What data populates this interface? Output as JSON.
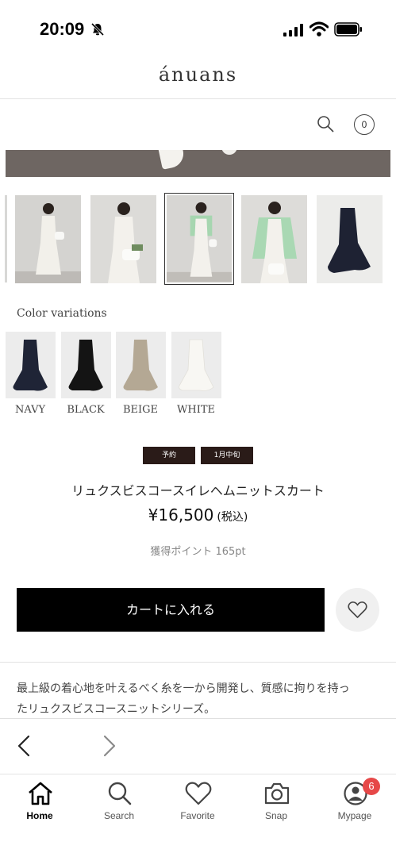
{
  "status_bar": {
    "time": "20:09"
  },
  "header": {
    "logo": "ánuans",
    "cart_count": "0"
  },
  "color_variations": {
    "title": "Color variations",
    "items": [
      {
        "label": "NAVY",
        "color": "#1f2436"
      },
      {
        "label": "BLACK",
        "color": "#141414"
      },
      {
        "label": "BEIGE",
        "color": "#b4a894"
      },
      {
        "label": "WHITE",
        "color": "#f4f2ec"
      }
    ]
  },
  "product": {
    "tags": [
      "予約",
      "1月中旬"
    ],
    "name": "リュクスビスコースイレヘムニットスカート",
    "price": "¥16,500",
    "tax_label": "(税込)",
    "points": "獲得ポイント 165pt",
    "cart_button": "カートに入れる",
    "description_line1": "最上級の着心地を叶えるべく糸を一から開発し、質感に拘りを持っ",
    "description_line2": "たリュクスビスコースニットシリーズ。"
  },
  "tabbar": {
    "items": [
      {
        "label": "Home",
        "icon": "home-icon"
      },
      {
        "label": "Search",
        "icon": "search-icon"
      },
      {
        "label": "Favorite",
        "icon": "heart-icon"
      },
      {
        "label": "Snap",
        "icon": "camera-icon"
      },
      {
        "label": "Mypage",
        "icon": "user-icon"
      }
    ],
    "mypage_badge": "6"
  },
  "colors": {
    "accent": "#000000",
    "tag_bg": "#2a1b18",
    "badge": "#e64848"
  }
}
